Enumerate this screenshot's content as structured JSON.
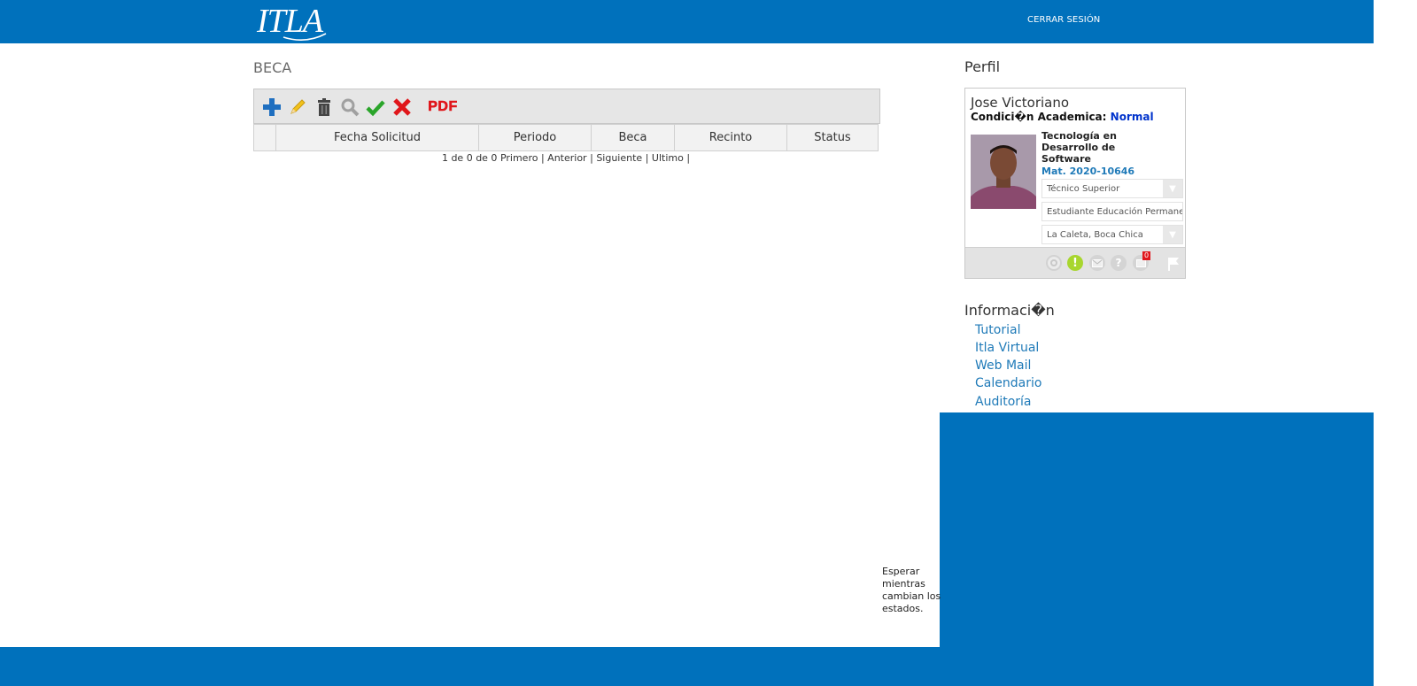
{
  "header": {
    "logo_text": "ITLA",
    "logout_label": "CERRAR SESIÓN",
    "bar_color": "#0071bc"
  },
  "main": {
    "title": "BECA",
    "toolbar": [
      {
        "name": "add-icon",
        "color": "#1f6fc0"
      },
      {
        "name": "edit-pencil-icon",
        "color": "#f2c21b"
      },
      {
        "name": "delete-trash-icon",
        "color": "#444444"
      },
      {
        "name": "search-magnifier-icon",
        "color": "#9e9e9e"
      },
      {
        "name": "approve-check-icon",
        "color": "#2aa52a"
      },
      {
        "name": "reject-x-icon",
        "color": "#e0161b"
      },
      {
        "name": "pdf-export-icon",
        "color": "#e0161b",
        "label": "PDF"
      }
    ],
    "table": {
      "columns": [
        "",
        "Fecha Solicitud",
        "Periodo",
        "Beca",
        "Recinto",
        "Status"
      ],
      "rows": []
    },
    "pager": {
      "summary": "1 de 0 de 0",
      "first": "Primero",
      "prev": "Anterior",
      "next": "Siguiente",
      "last": "Ultimo",
      "sep": "|"
    },
    "wait_message": "Esperar mientras cambian los estados."
  },
  "profile": {
    "section_title": "Perfil",
    "name": "Jose Victoriano",
    "condition_label": "Condici�n Academica:",
    "condition_value": "Normal",
    "career": "Tecnología en Desarrollo de Software",
    "matricula": "Mat. 2020-10646",
    "selects": [
      {
        "value": "Técnico Superior"
      },
      {
        "value": "Estudiante Educación Permanente"
      },
      {
        "value": "La Caleta, Boca Chica"
      }
    ],
    "notification_count": "0",
    "status_icons": [
      "settings-gear-icon",
      "alert-icon",
      "mail-icon",
      "help-icon",
      "messages-icon",
      "flag-icon"
    ]
  },
  "info": {
    "section_title": "Informaci�n",
    "links": [
      "Tutorial",
      "Itla Virtual",
      "Web Mail",
      "Calendario",
      "Auditoría"
    ]
  }
}
